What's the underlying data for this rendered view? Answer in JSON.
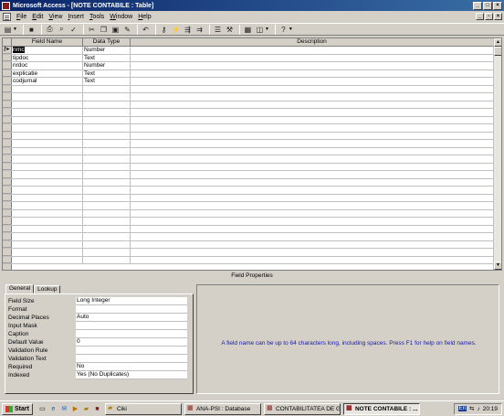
{
  "window": {
    "title": "Microsoft Access - [NOTE CONTABILE : Table]"
  },
  "menu": [
    "File",
    "Edit",
    "View",
    "Insert",
    "Tools",
    "Window",
    "Help"
  ],
  "menu_accel": [
    "F",
    "E",
    "V",
    "I",
    "T",
    "W",
    "H"
  ],
  "grid": {
    "headers": {
      "field_name": "Field Name",
      "data_type": "Data Type",
      "description": "Description"
    },
    "rows": [
      {
        "name": "nrnc",
        "type": "Number",
        "key": true
      },
      {
        "name": "tipdoc",
        "type": "Text"
      },
      {
        "name": "nrdoc",
        "type": "Number"
      },
      {
        "name": "explicatie",
        "type": "Text"
      },
      {
        "name": "codjurnal",
        "type": "Text"
      }
    ]
  },
  "field_properties": {
    "title": "Field Properties",
    "tabs": [
      "General",
      "Lookup"
    ],
    "props": [
      {
        "label": "Field Size",
        "value": "Long Integer"
      },
      {
        "label": "Format",
        "value": ""
      },
      {
        "label": "Decimal Places",
        "value": "Auto"
      },
      {
        "label": "Input Mask",
        "value": ""
      },
      {
        "label": "Caption",
        "value": ""
      },
      {
        "label": "Default Value",
        "value": "0"
      },
      {
        "label": "Validation Rule",
        "value": ""
      },
      {
        "label": "Validation Text",
        "value": ""
      },
      {
        "label": "Required",
        "value": "No"
      },
      {
        "label": "Indexed",
        "value": "Yes (No Duplicates)"
      }
    ],
    "help": "A field name can be up to 64 characters long, including spaces.  Press F1 for help on field names."
  },
  "taskbar": {
    "start": "Start",
    "tasks": [
      {
        "label": "Ciki",
        "active": false
      },
      {
        "label": "ANA-PSI : Database",
        "active": false
      },
      {
        "label": "CONTABILITATEA DE GE...",
        "active": false
      },
      {
        "label": "NOTE CONTABILE : ...",
        "active": true
      }
    ],
    "lang": "En",
    "clock": "20:19"
  }
}
